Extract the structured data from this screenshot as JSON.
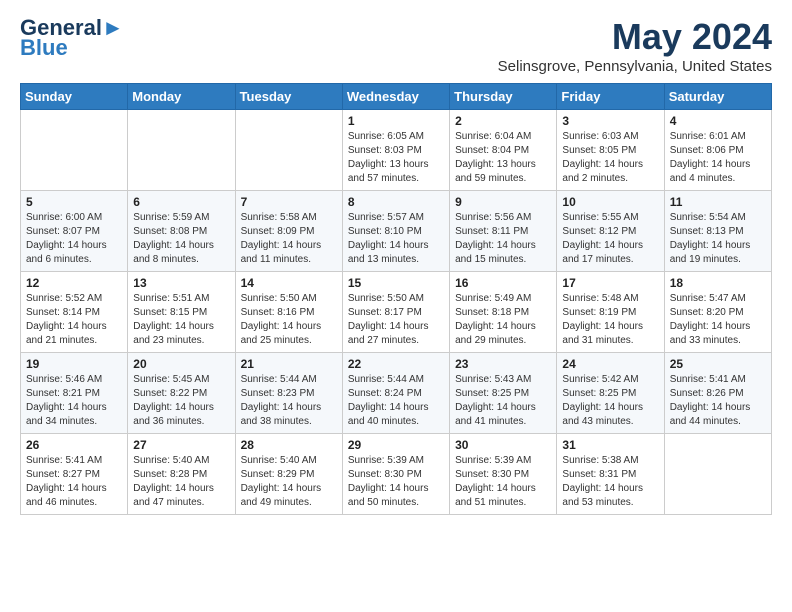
{
  "logo": {
    "line1": "General",
    "line2": "Blue"
  },
  "title": "May 2024",
  "subtitle": "Selinsgrove, Pennsylvania, United States",
  "days_of_week": [
    "Sunday",
    "Monday",
    "Tuesday",
    "Wednesday",
    "Thursday",
    "Friday",
    "Saturday"
  ],
  "weeks": [
    [
      {
        "day": "",
        "sunrise": "",
        "sunset": "",
        "daylight": ""
      },
      {
        "day": "",
        "sunrise": "",
        "sunset": "",
        "daylight": ""
      },
      {
        "day": "",
        "sunrise": "",
        "sunset": "",
        "daylight": ""
      },
      {
        "day": "1",
        "sunrise": "Sunrise: 6:05 AM",
        "sunset": "Sunset: 8:03 PM",
        "daylight": "Daylight: 13 hours and 57 minutes."
      },
      {
        "day": "2",
        "sunrise": "Sunrise: 6:04 AM",
        "sunset": "Sunset: 8:04 PM",
        "daylight": "Daylight: 13 hours and 59 minutes."
      },
      {
        "day": "3",
        "sunrise": "Sunrise: 6:03 AM",
        "sunset": "Sunset: 8:05 PM",
        "daylight": "Daylight: 14 hours and 2 minutes."
      },
      {
        "day": "4",
        "sunrise": "Sunrise: 6:01 AM",
        "sunset": "Sunset: 8:06 PM",
        "daylight": "Daylight: 14 hours and 4 minutes."
      }
    ],
    [
      {
        "day": "5",
        "sunrise": "Sunrise: 6:00 AM",
        "sunset": "Sunset: 8:07 PM",
        "daylight": "Daylight: 14 hours and 6 minutes."
      },
      {
        "day": "6",
        "sunrise": "Sunrise: 5:59 AM",
        "sunset": "Sunset: 8:08 PM",
        "daylight": "Daylight: 14 hours and 8 minutes."
      },
      {
        "day": "7",
        "sunrise": "Sunrise: 5:58 AM",
        "sunset": "Sunset: 8:09 PM",
        "daylight": "Daylight: 14 hours and 11 minutes."
      },
      {
        "day": "8",
        "sunrise": "Sunrise: 5:57 AM",
        "sunset": "Sunset: 8:10 PM",
        "daylight": "Daylight: 14 hours and 13 minutes."
      },
      {
        "day": "9",
        "sunrise": "Sunrise: 5:56 AM",
        "sunset": "Sunset: 8:11 PM",
        "daylight": "Daylight: 14 hours and 15 minutes."
      },
      {
        "day": "10",
        "sunrise": "Sunrise: 5:55 AM",
        "sunset": "Sunset: 8:12 PM",
        "daylight": "Daylight: 14 hours and 17 minutes."
      },
      {
        "day": "11",
        "sunrise": "Sunrise: 5:54 AM",
        "sunset": "Sunset: 8:13 PM",
        "daylight": "Daylight: 14 hours and 19 minutes."
      }
    ],
    [
      {
        "day": "12",
        "sunrise": "Sunrise: 5:52 AM",
        "sunset": "Sunset: 8:14 PM",
        "daylight": "Daylight: 14 hours and 21 minutes."
      },
      {
        "day": "13",
        "sunrise": "Sunrise: 5:51 AM",
        "sunset": "Sunset: 8:15 PM",
        "daylight": "Daylight: 14 hours and 23 minutes."
      },
      {
        "day": "14",
        "sunrise": "Sunrise: 5:50 AM",
        "sunset": "Sunset: 8:16 PM",
        "daylight": "Daylight: 14 hours and 25 minutes."
      },
      {
        "day": "15",
        "sunrise": "Sunrise: 5:50 AM",
        "sunset": "Sunset: 8:17 PM",
        "daylight": "Daylight: 14 hours and 27 minutes."
      },
      {
        "day": "16",
        "sunrise": "Sunrise: 5:49 AM",
        "sunset": "Sunset: 8:18 PM",
        "daylight": "Daylight: 14 hours and 29 minutes."
      },
      {
        "day": "17",
        "sunrise": "Sunrise: 5:48 AM",
        "sunset": "Sunset: 8:19 PM",
        "daylight": "Daylight: 14 hours and 31 minutes."
      },
      {
        "day": "18",
        "sunrise": "Sunrise: 5:47 AM",
        "sunset": "Sunset: 8:20 PM",
        "daylight": "Daylight: 14 hours and 33 minutes."
      }
    ],
    [
      {
        "day": "19",
        "sunrise": "Sunrise: 5:46 AM",
        "sunset": "Sunset: 8:21 PM",
        "daylight": "Daylight: 14 hours and 34 minutes."
      },
      {
        "day": "20",
        "sunrise": "Sunrise: 5:45 AM",
        "sunset": "Sunset: 8:22 PM",
        "daylight": "Daylight: 14 hours and 36 minutes."
      },
      {
        "day": "21",
        "sunrise": "Sunrise: 5:44 AM",
        "sunset": "Sunset: 8:23 PM",
        "daylight": "Daylight: 14 hours and 38 minutes."
      },
      {
        "day": "22",
        "sunrise": "Sunrise: 5:44 AM",
        "sunset": "Sunset: 8:24 PM",
        "daylight": "Daylight: 14 hours and 40 minutes."
      },
      {
        "day": "23",
        "sunrise": "Sunrise: 5:43 AM",
        "sunset": "Sunset: 8:25 PM",
        "daylight": "Daylight: 14 hours and 41 minutes."
      },
      {
        "day": "24",
        "sunrise": "Sunrise: 5:42 AM",
        "sunset": "Sunset: 8:25 PM",
        "daylight": "Daylight: 14 hours and 43 minutes."
      },
      {
        "day": "25",
        "sunrise": "Sunrise: 5:41 AM",
        "sunset": "Sunset: 8:26 PM",
        "daylight": "Daylight: 14 hours and 44 minutes."
      }
    ],
    [
      {
        "day": "26",
        "sunrise": "Sunrise: 5:41 AM",
        "sunset": "Sunset: 8:27 PM",
        "daylight": "Daylight: 14 hours and 46 minutes."
      },
      {
        "day": "27",
        "sunrise": "Sunrise: 5:40 AM",
        "sunset": "Sunset: 8:28 PM",
        "daylight": "Daylight: 14 hours and 47 minutes."
      },
      {
        "day": "28",
        "sunrise": "Sunrise: 5:40 AM",
        "sunset": "Sunset: 8:29 PM",
        "daylight": "Daylight: 14 hours and 49 minutes."
      },
      {
        "day": "29",
        "sunrise": "Sunrise: 5:39 AM",
        "sunset": "Sunset: 8:30 PM",
        "daylight": "Daylight: 14 hours and 50 minutes."
      },
      {
        "day": "30",
        "sunrise": "Sunrise: 5:39 AM",
        "sunset": "Sunset: 8:30 PM",
        "daylight": "Daylight: 14 hours and 51 minutes."
      },
      {
        "day": "31",
        "sunrise": "Sunrise: 5:38 AM",
        "sunset": "Sunset: 8:31 PM",
        "daylight": "Daylight: 14 hours and 53 minutes."
      },
      {
        "day": "",
        "sunrise": "",
        "sunset": "",
        "daylight": ""
      }
    ]
  ]
}
